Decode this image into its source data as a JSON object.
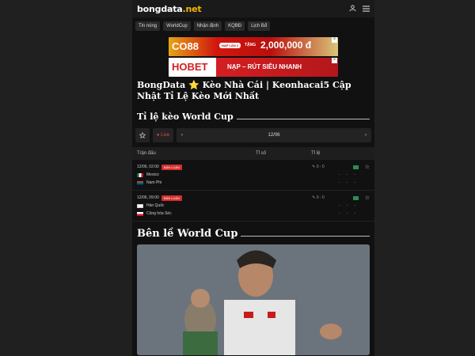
{
  "logo": {
    "main": "bongdata",
    "suffix": ".net"
  },
  "nav": [
    "Tin nóng",
    "WorldCup",
    "Nhận định",
    "KQBĐ",
    "Lịch Bđ"
  ],
  "banners": {
    "b1": {
      "brand": "CO88",
      "pill": "NẠP LẦN 2",
      "text": "TẶNG",
      "amount": "2,000,000 đ"
    },
    "b2": {
      "brand": "HOBET",
      "text": "NẠP – RÚT SIÊU NHANH"
    }
  },
  "headline": {
    "part1": "BongData ",
    "star": "⭐",
    "part2": " Kèo Nhà Cái | Keonhacai5 Cập Nhật Tỉ Lệ Kèo Mới Nhất"
  },
  "odds_section": {
    "title": "Tỉ lệ kèo World Cup",
    "live_label": "● Live",
    "date": "12/06",
    "col_match": "Trận đấu",
    "col_score": "Tỉ số",
    "col_odds": "Tỉ lệ"
  },
  "matches": [
    {
      "time": "12/06, 02:00",
      "badge": "BẢN LUẬN",
      "team1": "Mexico",
      "team2": "Nam Phi",
      "score": "0 - 0"
    },
    {
      "time": "12/06, 09:00",
      "badge": "BẢN LUẬN",
      "team1": "Hàn Quốc",
      "team2": "Cộng hòa Séc",
      "score": "0 - 0"
    }
  ],
  "dash": "-",
  "side_section": {
    "title": "Bên lề World Cup"
  }
}
